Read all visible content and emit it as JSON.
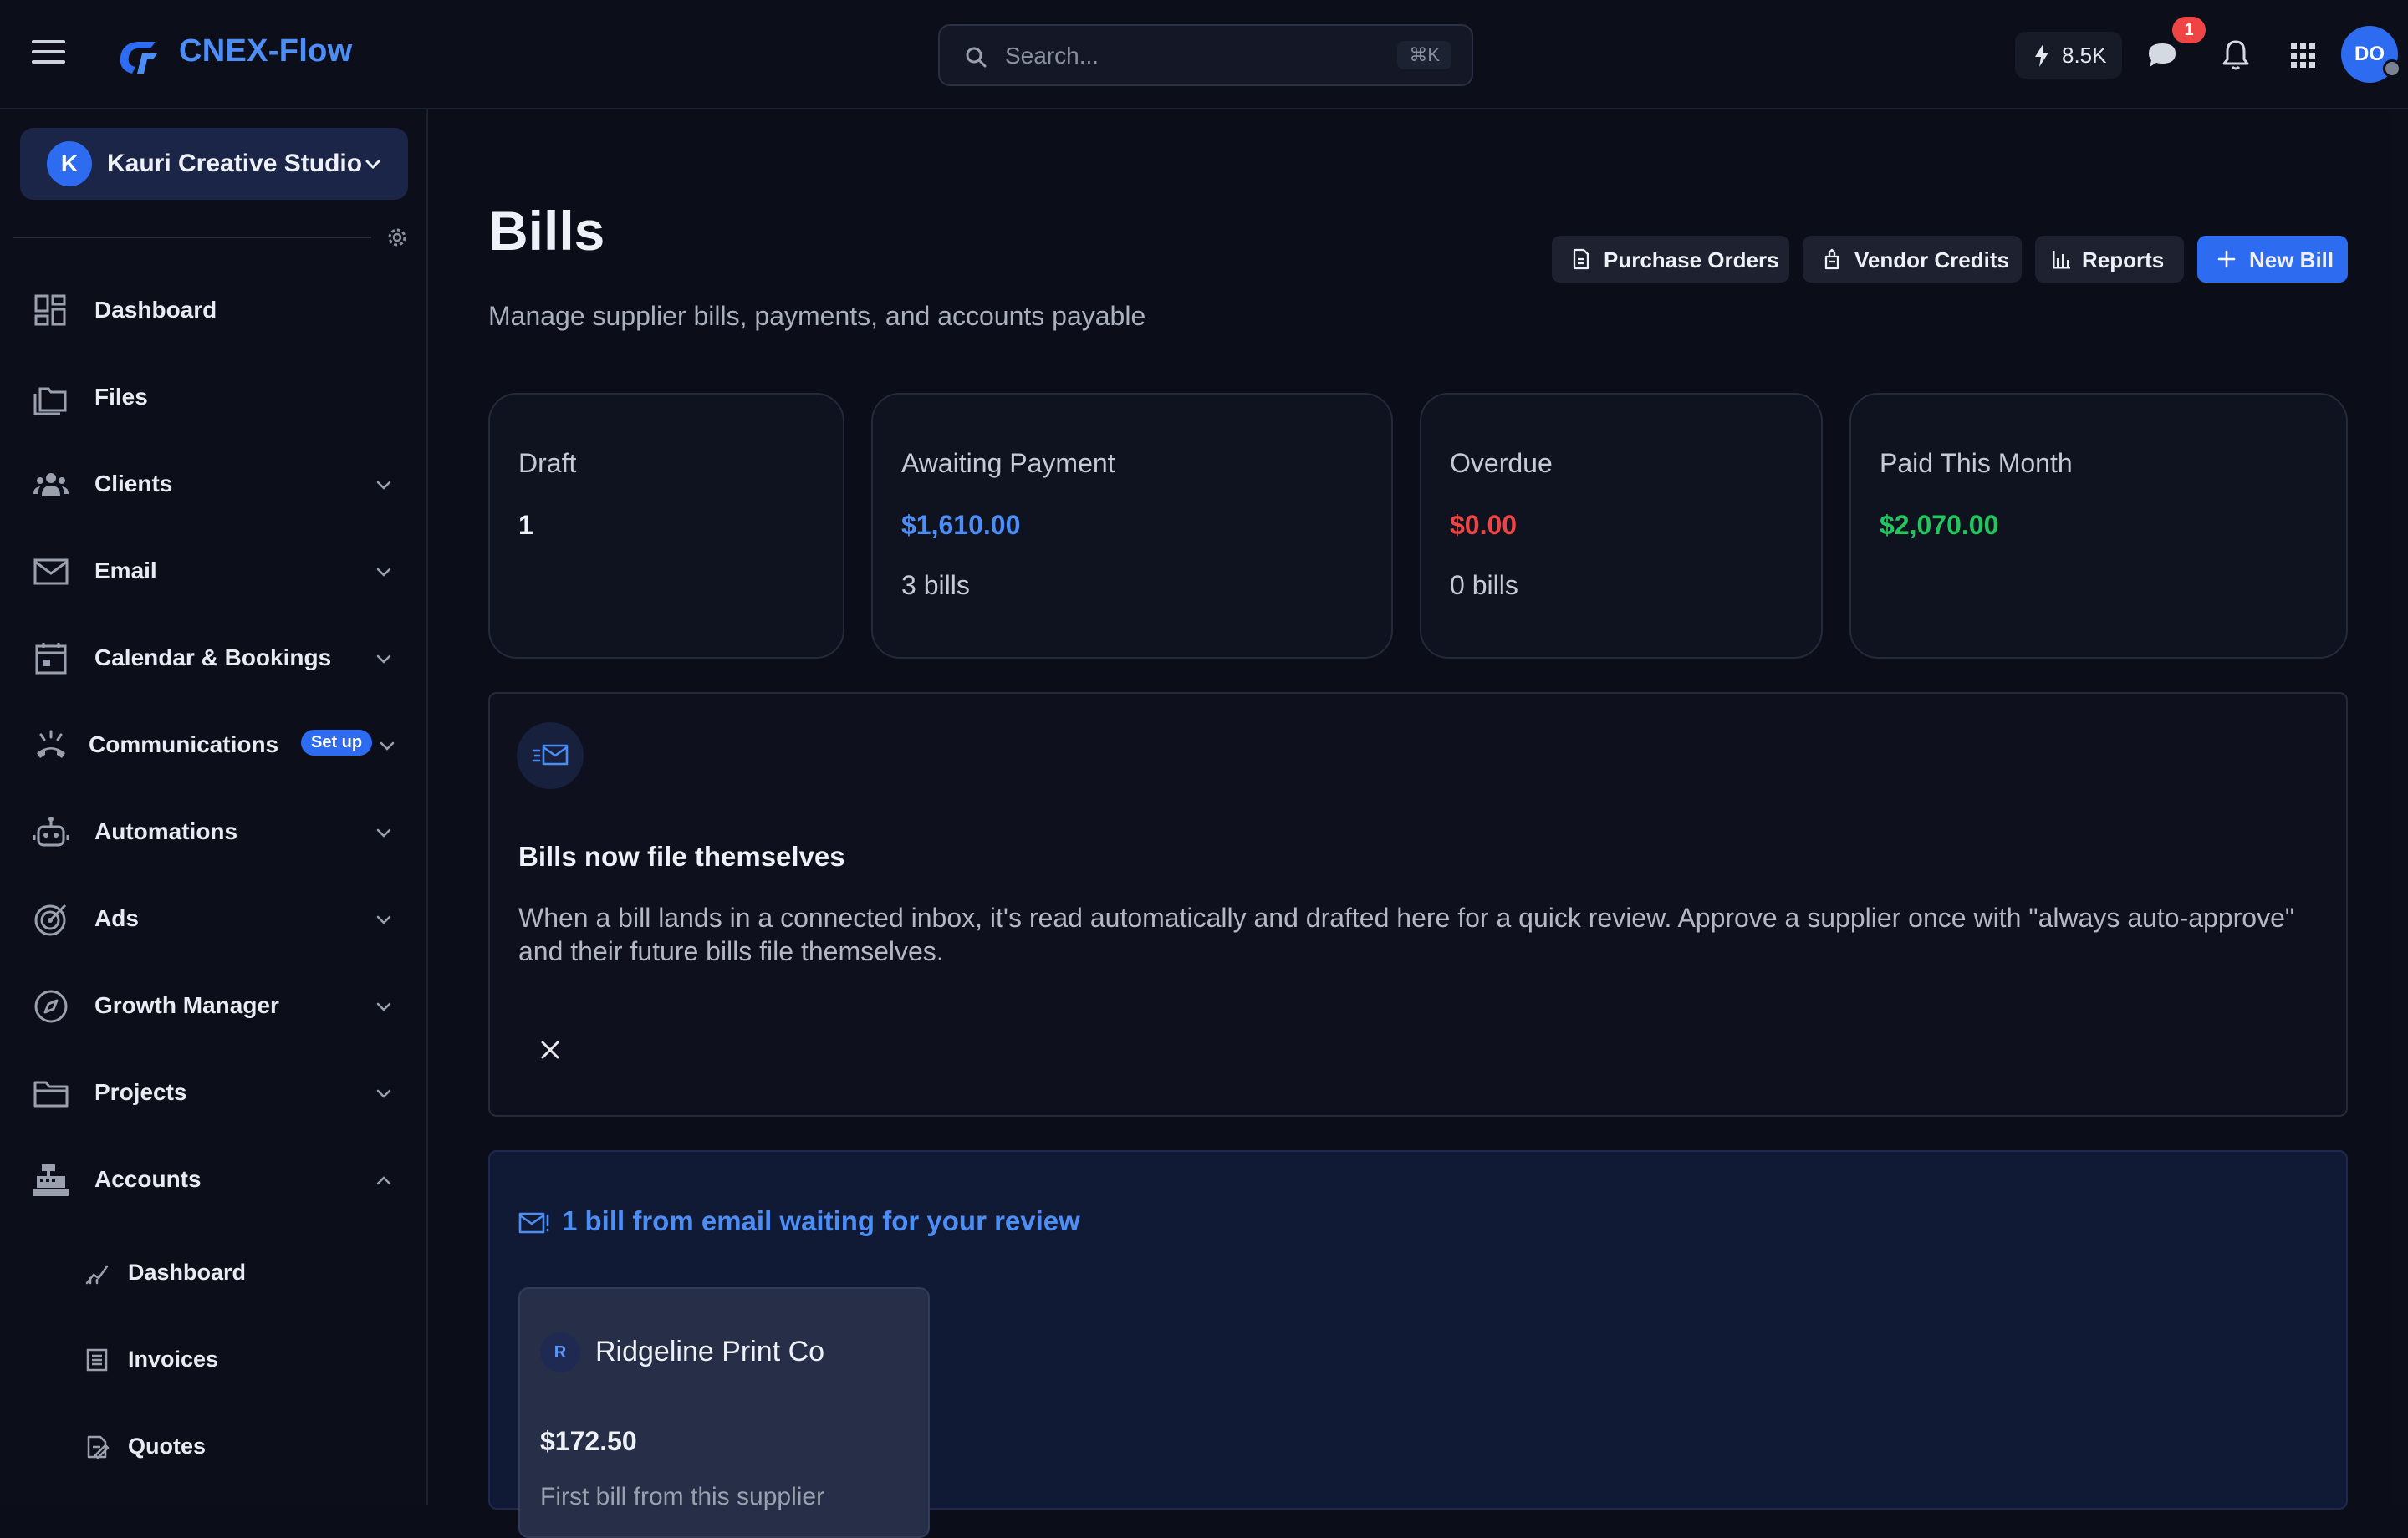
{
  "app": {
    "name": "CNEX-Flow",
    "search_placeholder": "Search...",
    "search_shortcut": "⌘K",
    "credits": "8.5K",
    "messages_badge": "1",
    "avatar_initials": "DO"
  },
  "org": {
    "initial": "K",
    "name": "Kauri Creative Studio"
  },
  "sidebar": {
    "items": [
      {
        "label": "Dashboard",
        "icon": "dashboard-icon",
        "has_chevron": false
      },
      {
        "label": "Files",
        "icon": "files-icon",
        "has_chevron": false
      },
      {
        "label": "Clients",
        "icon": "clients-icon",
        "has_chevron": true
      },
      {
        "label": "Email",
        "icon": "mail-icon",
        "has_chevron": true
      },
      {
        "label": "Calendar & Bookings",
        "icon": "calendar-icon",
        "has_chevron": true
      },
      {
        "label": "Communications",
        "icon": "phone-icon",
        "has_chevron": true,
        "badge": "Set up"
      },
      {
        "label": "Automations",
        "icon": "robot-icon",
        "has_chevron": true
      },
      {
        "label": "Ads",
        "icon": "target-icon",
        "has_chevron": true
      },
      {
        "label": "Growth Manager",
        "icon": "compass-icon",
        "has_chevron": true
      },
      {
        "label": "Projects",
        "icon": "folder-icon",
        "has_chevron": true
      },
      {
        "label": "Accounts",
        "icon": "register-icon",
        "has_chevron": true,
        "expanded": true
      }
    ],
    "sub_items": [
      {
        "label": "Dashboard",
        "icon": "chart-icon"
      },
      {
        "label": "Invoices",
        "icon": "list-icon"
      },
      {
        "label": "Quotes",
        "icon": "quote-icon"
      }
    ]
  },
  "page": {
    "title": "Bills",
    "subtitle": "Manage supplier bills, payments, and accounts payable",
    "actions": [
      {
        "label": "Purchase Orders",
        "icon": "document-icon"
      },
      {
        "label": "Vendor Credits",
        "icon": "credit-icon"
      },
      {
        "label": "Reports",
        "icon": "bar-chart-icon"
      },
      {
        "label": "New Bill",
        "icon": "plus-icon",
        "primary": true
      }
    ]
  },
  "stats": [
    {
      "label": "Draft",
      "value": "1",
      "sub": "",
      "color": "#eef1f7"
    },
    {
      "label": "Awaiting Payment",
      "value": "$1,610.00",
      "sub": "3 bills",
      "color": "#4d8df6"
    },
    {
      "label": "Overdue",
      "value": "$0.00",
      "sub": "0 bills",
      "color": "#ef4444"
    },
    {
      "label": "Paid This Month",
      "value": "$2,070.00",
      "sub": "",
      "color": "#22c55e"
    }
  ],
  "promo": {
    "title": "Bills now file themselves",
    "body": "When a bill lands in a connected inbox, it's read automatically and drafted here for a quick review. Approve a supplier once with \"always auto-approve\" and their future bills file themselves."
  },
  "review": {
    "heading": "1 bill from email waiting for your review",
    "card": {
      "initial": "R",
      "vendor": "Ridgeline Print Co",
      "amount": "$172.50",
      "note": "First bill from this supplier"
    }
  }
}
